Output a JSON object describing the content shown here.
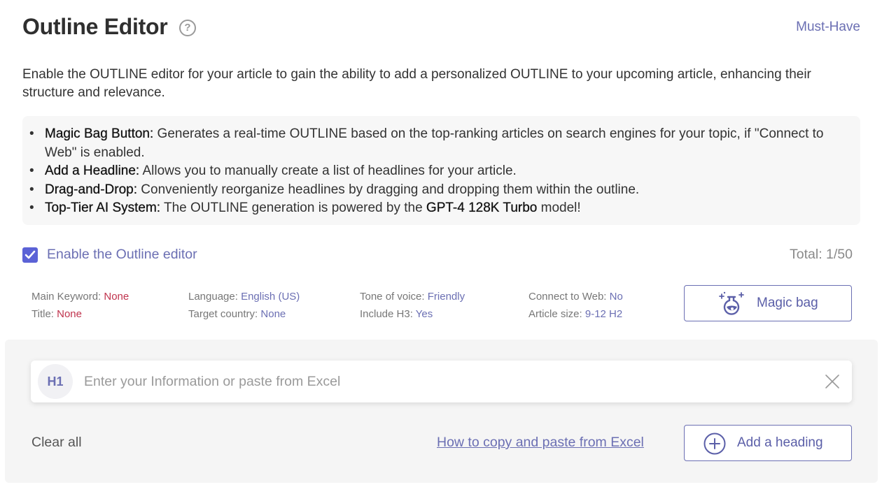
{
  "header": {
    "title": "Outline Editor",
    "help_icon": "question-circle-icon",
    "badge": "Must-Have"
  },
  "intro": "Enable the OUTLINE editor for your article to gain the ability to add a personalized OUTLINE to your upcoming article, enhancing their structure and relevance.",
  "features": [
    {
      "title": "Magic Bag Button:",
      "text": " Generates a real-time OUTLINE based on the top-ranking articles on search engines for your topic, if \"Connect to Web\" is enabled."
    },
    {
      "title": "Add a Headline:",
      "text": " Allows you to manually create a list of headlines for your article."
    },
    {
      "title": "Drag-and-Drop:",
      "text": " Conveniently reorganize headlines by dragging and dropping them within the outline."
    },
    {
      "title": "Top-Tier AI System:",
      "text_before": " The OUTLINE generation is powered by the ",
      "model": "GPT-4 128K Turbo",
      "text_after": " model!"
    }
  ],
  "enable": {
    "label": "Enable the Outline editor",
    "checked": true,
    "total": "Total: 1/50"
  },
  "settings": {
    "main_keyword": {
      "label": "Main Keyword: ",
      "value": "None"
    },
    "title": {
      "label": "Title: ",
      "value": "None"
    },
    "language": {
      "label": "Language: ",
      "value": "English (US)"
    },
    "target_country": {
      "label": "Target country: ",
      "value": "None"
    },
    "tone": {
      "label": "Tone of voice: ",
      "value": "Friendly"
    },
    "include_h3": {
      "label": "Include H3: ",
      "value": "Yes"
    },
    "connect_web": {
      "label": "Connect to Web: ",
      "value": "No"
    },
    "article_size": {
      "label": "Article size: ",
      "value": "9-12 H2"
    }
  },
  "magic_button": {
    "label": "Magic bag",
    "icon": "magic-flask-icon"
  },
  "outline": {
    "heading_level": "H1",
    "placeholder": "Enter your Information or paste from Excel",
    "value": ""
  },
  "footer": {
    "clear_all": "Clear all",
    "howto_link": "How to copy and paste from Excel",
    "add_heading": "Add a heading"
  },
  "colors": {
    "accent": "#6b6fb3",
    "checkbox": "#5b62d6",
    "none_value": "#c0334d"
  }
}
